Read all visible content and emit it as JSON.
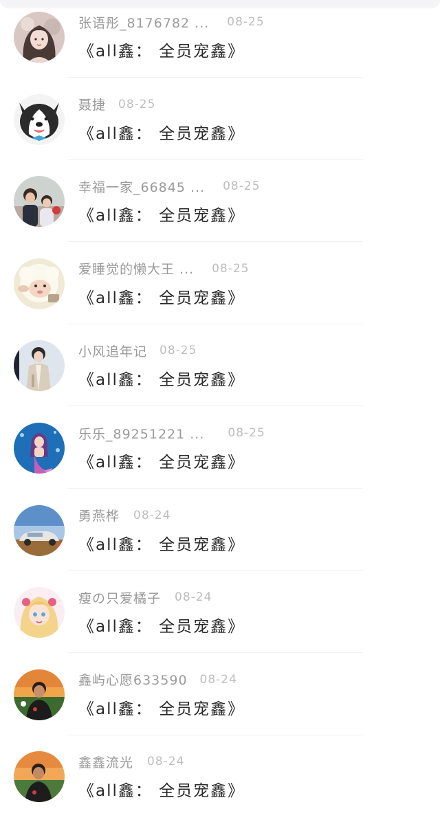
{
  "comments": [
    {
      "name": "张语彤_8176782 ...",
      "date": "08-25",
      "title": "《all鑫： 全员宠鑫》",
      "avatar": "avatar-anime-girl-icon"
    },
    {
      "name": "聂捷",
      "date": "08-25",
      "title": "《all鑫： 全员宠鑫》",
      "avatar": "avatar-husky-dog-icon"
    },
    {
      "name": "幸福一家_66845 ...",
      "date": "08-25",
      "title": "《all鑫： 全员宠鑫》",
      "avatar": "avatar-family-photo-icon"
    },
    {
      "name": "爱睡觉的懒大王 ...",
      "date": "08-25",
      "title": "《all鑫： 全员宠鑫》",
      "avatar": "avatar-sheep-cartoon-icon"
    },
    {
      "name": "小风追年记",
      "date": "08-25",
      "title": "《all鑫： 全员宠鑫》",
      "avatar": "avatar-man-coat-icon"
    },
    {
      "name": "乐乐_89251221 ...",
      "date": "08-25",
      "title": "《all鑫： 全员宠鑫》",
      "avatar": "avatar-mermaid-icon"
    },
    {
      "name": "勇燕桦",
      "date": "08-24",
      "title": "《all鑫： 全员宠鑫》",
      "avatar": "avatar-car-sky-icon"
    },
    {
      "name": "瘦の只爱橘子",
      "date": "08-24",
      "title": "《all鑫： 全员宠鑫》",
      "avatar": "avatar-anime-blonde-icon"
    },
    {
      "name": "鑫屿心愿633590",
      "date": "08-24",
      "title": "《all鑫： 全员宠鑫》",
      "avatar": "avatar-man-sunset-icon"
    },
    {
      "name": "鑫鑫流光",
      "date": "08-24",
      "title": "《all鑫： 全员宠鑫》",
      "avatar": "avatar-man-beach-icon"
    }
  ]
}
